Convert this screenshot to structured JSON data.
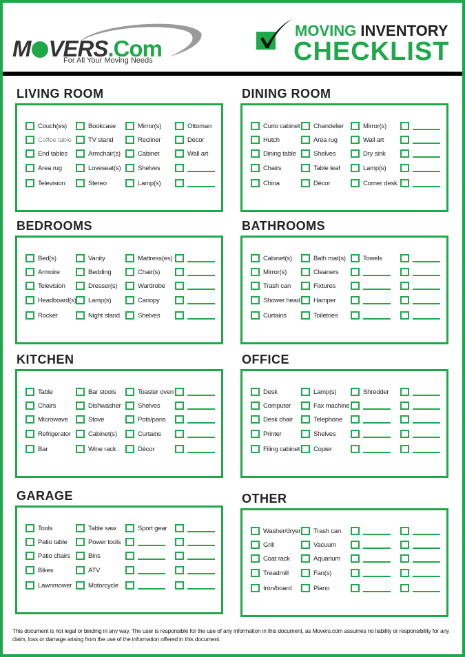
{
  "header": {
    "logo": {
      "name": "MOVERS",
      "dotcom": ".Com",
      "tagline": "For All Your Moving Needs"
    },
    "title": {
      "word1": "MOVING",
      "word2": "INVENTORY",
      "line2": "CHECKLIST"
    },
    "check_icon": "checkmark-box-icon"
  },
  "colors": {
    "accent": "#1fa84a",
    "text": "#222222",
    "rule": "#000000"
  },
  "sections": [
    {
      "title": "LIVING ROOM",
      "columns": [
        [
          "Couch(es)",
          "Coffee table",
          "End tables",
          "Area rug",
          "Television"
        ],
        [
          "Bookcase",
          "TV stand",
          "Armchair(s)",
          "Loveseat(s)",
          "Stereo"
        ],
        [
          "Mirror(s)",
          "Recliner",
          "Cabinet",
          "Shelves",
          "Lamp(s)"
        ],
        [
          "Ottoman",
          "Décor",
          "Wall art",
          "",
          ""
        ]
      ]
    },
    {
      "title": "DINING ROOM",
      "columns": [
        [
          "Curio cabinet",
          "Hutch",
          "Dining table",
          "Chairs",
          "China"
        ],
        [
          "Chandelier",
          "Area rug",
          "Shelves",
          "Table leaf",
          "Décor"
        ],
        [
          "Mirror(s)",
          "Wall art",
          "Dry sink",
          "Lamp(s)",
          "Corner desk"
        ],
        [
          "",
          "",
          "",
          "",
          ""
        ]
      ]
    },
    {
      "title": "BEDROOMS",
      "columns": [
        [
          "Bed(s)",
          "Armoire",
          "Television",
          "Headboard(s)",
          "Rocker"
        ],
        [
          "Vanity",
          "Bedding",
          "Dresser(s)",
          "Lamp(s)",
          "Night stand"
        ],
        [
          "Mattress(es)",
          "Chair(s)",
          "Wardrobe",
          "Canopy",
          "Shelves"
        ],
        [
          "",
          "",
          "",
          "",
          ""
        ]
      ]
    },
    {
      "title": "BATHROOMS",
      "columns": [
        [
          "Cabinet(s)",
          "Mirror(s)",
          "Trash can",
          "Shower head",
          "Curtains"
        ],
        [
          "Bath mat(s)",
          "Cleaners",
          "Fixtures",
          "Hamper",
          "Toiletries"
        ],
        [
          "Towels",
          "",
          "",
          "",
          ""
        ],
        [
          "",
          "",
          "",
          "",
          ""
        ]
      ]
    },
    {
      "title": "KITCHEN",
      "columns": [
        [
          "Table",
          "Chairs",
          "Microwave",
          "Refrigerator",
          "Bar"
        ],
        [
          "Bar stools",
          "Dishwasher",
          "Stove",
          "Cabinet(s)",
          "Wine rack"
        ],
        [
          "Toaster oven",
          "Shelves",
          "Pots/pans",
          "Curtains",
          "Décor"
        ],
        [
          "",
          "",
          "",
          "",
          ""
        ]
      ]
    },
    {
      "title": "OFFICE",
      "columns": [
        [
          "Desk",
          "Computer",
          "Desk chair",
          "Printer",
          "Filing cabinet"
        ],
        [
          "Lamp(s)",
          "Fax machine",
          "Telephone",
          "Shelves",
          "Copier"
        ],
        [
          "Shredder",
          "",
          "",
          "",
          ""
        ],
        [
          "",
          "",
          "",
          "",
          ""
        ]
      ]
    },
    {
      "title": "GARAGE",
      "columns": [
        [
          "Tools",
          "Patio table",
          "Patio chairs",
          "Bikes",
          "Lawnmower"
        ],
        [
          "Table saw",
          "Power tools",
          "Bins",
          "ATV",
          "Motorcycle"
        ],
        [
          "Sport gear",
          "",
          "",
          "",
          ""
        ],
        [
          "",
          "",
          "",
          "",
          ""
        ]
      ]
    },
    {
      "title": "OTHER",
      "columns": [
        [
          "Washer/dryer",
          "Grill",
          "Coat rack",
          "Treadmill",
          "Iron/board"
        ],
        [
          "Trash can",
          "Vacuum",
          "Aquarium",
          "Fan(s)",
          "Piano"
        ],
        [
          "",
          "",
          "",
          "",
          ""
        ],
        [
          "",
          "",
          "",
          "",
          ""
        ]
      ]
    }
  ],
  "footer": {
    "disclaimer": "This document is not legal or binding in any way. The user is responsible for the use of any information in this document, as Movers.com assumes no liability or responsibility for any claim, loss or damage arising from the use of the information offered in this document."
  }
}
